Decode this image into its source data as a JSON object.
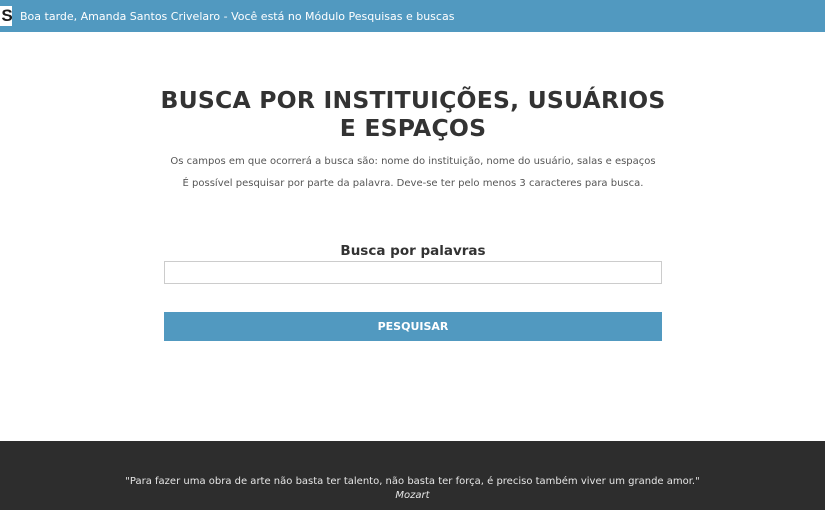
{
  "header": {
    "logo_letter": "S",
    "greeting": "Boa tarde, Amanda Santos Crivelaro - Você está no Módulo Pesquisas e buscas"
  },
  "main": {
    "title_line1": "BUSCA POR INSTITUIÇÕES, USUÁRIOS",
    "title_line2": "E ESPAÇOS",
    "description1": "Os campos em que ocorrerá a busca são: nome do instituição, nome do usuário, salas e espaços",
    "description2": "É possível pesquisar por parte da palavra. Deve-se ter pelo menos 3 caracteres para busca.",
    "search_label": "Busca por palavras",
    "search_value": "",
    "search_button": "PESQUISAR"
  },
  "footer": {
    "quote": "\"Para fazer uma obra de arte não basta ter talento, não basta ter força, é preciso também viver um grande amor.\"",
    "author": "Mozart"
  },
  "colors": {
    "accent": "#5199c0",
    "footer_bg": "#2d2d2d"
  }
}
